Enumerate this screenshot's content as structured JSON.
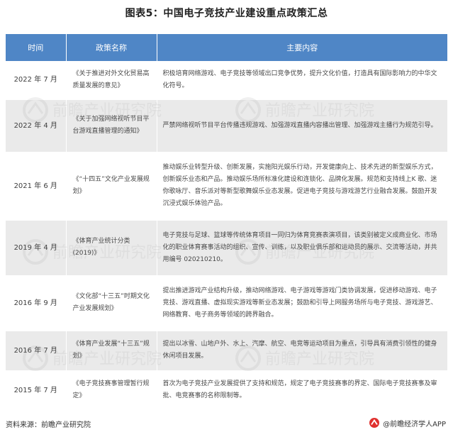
{
  "title": "图表5：中国电子竞技产业建设重点政策汇总",
  "table": {
    "headers": {
      "time": "时间",
      "name": "政策名称",
      "content": "主要内容"
    },
    "rows": [
      {
        "time": "2022 年 7 月",
        "name": "《关于推进对外文化贸易高质量发展的意见》",
        "content": "积极培育网络游戏、电子竞技等领域出口竞争优势，提升文化价值，打造具有国际影响力的中华文化符号。"
      },
      {
        "time": "2022 年 4 月",
        "name": "《关于加强网络视听节目平台游戏直播管理的通知》",
        "content": "严禁网络视听节目平台传播违规游戏、加强游戏直播内容播出管理、加强游戏主播行为规范引导。"
      },
      {
        "time": "2021 年 6 月",
        "name": "《“十四五”文化产业发展规划》",
        "content": "推动娱乐业转型升级、创新发展，实施阳光娱乐行动，开发健康向上、技术先进的新型娱乐方式，创新娱乐业态和产品。推动娱乐场所标准化建设和连锁化、品牌化发展。规范和支持线上K 歌、迷你歌咏厅、音乐派对等新型歌舞娱乐业态发展。促进电子竞技与游戏游艺行业融合发展。鼓励开发沉浸式娱乐体验产品。"
      },
      {
        "time": "2019 年 4 月",
        "name": "《体育产业统计分类(2019)》",
        "content": "电子竞技与足球、篮球等传统体育项目一同归为体育竞赛表演项目，该类别被定义成商业化、市场化的职业体育赛事活动的组织、宣传、训练，以及职业俱乐部和运动员的展示、交流等活动，并共用编号 020210210。"
      },
      {
        "time": "2016 年 9 月",
        "name": "《文化部“十三五”时期文化产业发展规划》",
        "content": "提出推进游戏产业结构升级，推动网络游戏、电子游戏等游戏门类协调发展，促进移动游戏、电子竞技、游戏直播、虚拟现实游戏等新业态发展；鼓励和引导上网服务场所与电子竞技、游戏游艺、网络教育、电子商务等领域的跨界融合。"
      },
      {
        "time": "2016 年 7 月",
        "name": "《体育产业发展“十三五”规划》",
        "content": "提出以冰雪、山地户外、水上、汽摩、航空、电竞等运动项目为重点，引导具有消费引领性的健身休闲项目发展。"
      },
      {
        "time": "2015 年 7 月",
        "name": "《电子竞技赛事管理暂行规定》",
        "content": "首次为电子竞技产业发展提供了支持和规范，规定了电子竞技赛事的界定、国际电子竞技赛事及审批、电竞赛事的名称限制等。"
      }
    ]
  },
  "footer": {
    "source": "资料来源：前瞻产业研究院",
    "brand": "@前瞻经济学人APP"
  },
  "watermark": {
    "text": "前瞻产业研究院",
    "icon": "qianzhan-logo-icon"
  },
  "colors": {
    "header_bg": "#4f86c6",
    "row_alt_bg": "#eaeaea",
    "brand_red": "#e0312f"
  }
}
